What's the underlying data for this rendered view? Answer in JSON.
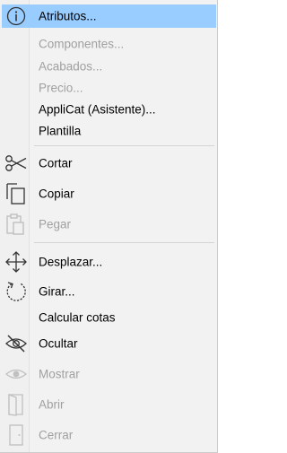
{
  "menu": {
    "items": [
      {
        "label": "Atributos...",
        "icon": "info-icon",
        "enabled": true,
        "highlighted": true
      },
      {
        "label": "Componentes...",
        "icon": null,
        "enabled": false
      },
      {
        "label": "Acabados...",
        "icon": null,
        "enabled": false
      },
      {
        "label": "Precio...",
        "icon": null,
        "enabled": false
      },
      {
        "label": "AppliCat (Asistente)...",
        "icon": null,
        "enabled": true
      },
      {
        "label": "Plantilla",
        "icon": null,
        "enabled": true
      },
      {
        "label": "Cortar",
        "icon": "scissors-icon",
        "enabled": true
      },
      {
        "label": "Copiar",
        "icon": "copy-icon",
        "enabled": true
      },
      {
        "label": "Pegar",
        "icon": "paste-icon",
        "enabled": false
      },
      {
        "label": "Desplazar...",
        "icon": "move-icon",
        "enabled": true
      },
      {
        "label": "Girar...",
        "icon": "rotate-icon",
        "enabled": true
      },
      {
        "label": "Calcular cotas",
        "icon": null,
        "enabled": true
      },
      {
        "label": "Ocultar",
        "icon": "eye-off-icon",
        "enabled": true
      },
      {
        "label": "Mostrar",
        "icon": "eye-icon",
        "enabled": false
      },
      {
        "label": "Abrir",
        "icon": "door-open-icon",
        "enabled": false
      },
      {
        "label": "Cerrar",
        "icon": "door-closed-icon",
        "enabled": false
      }
    ]
  },
  "colors": {
    "highlight": "#99ccff",
    "disabled_text": "#a0a0a0",
    "menu_bg": "#f2f2f2"
  }
}
